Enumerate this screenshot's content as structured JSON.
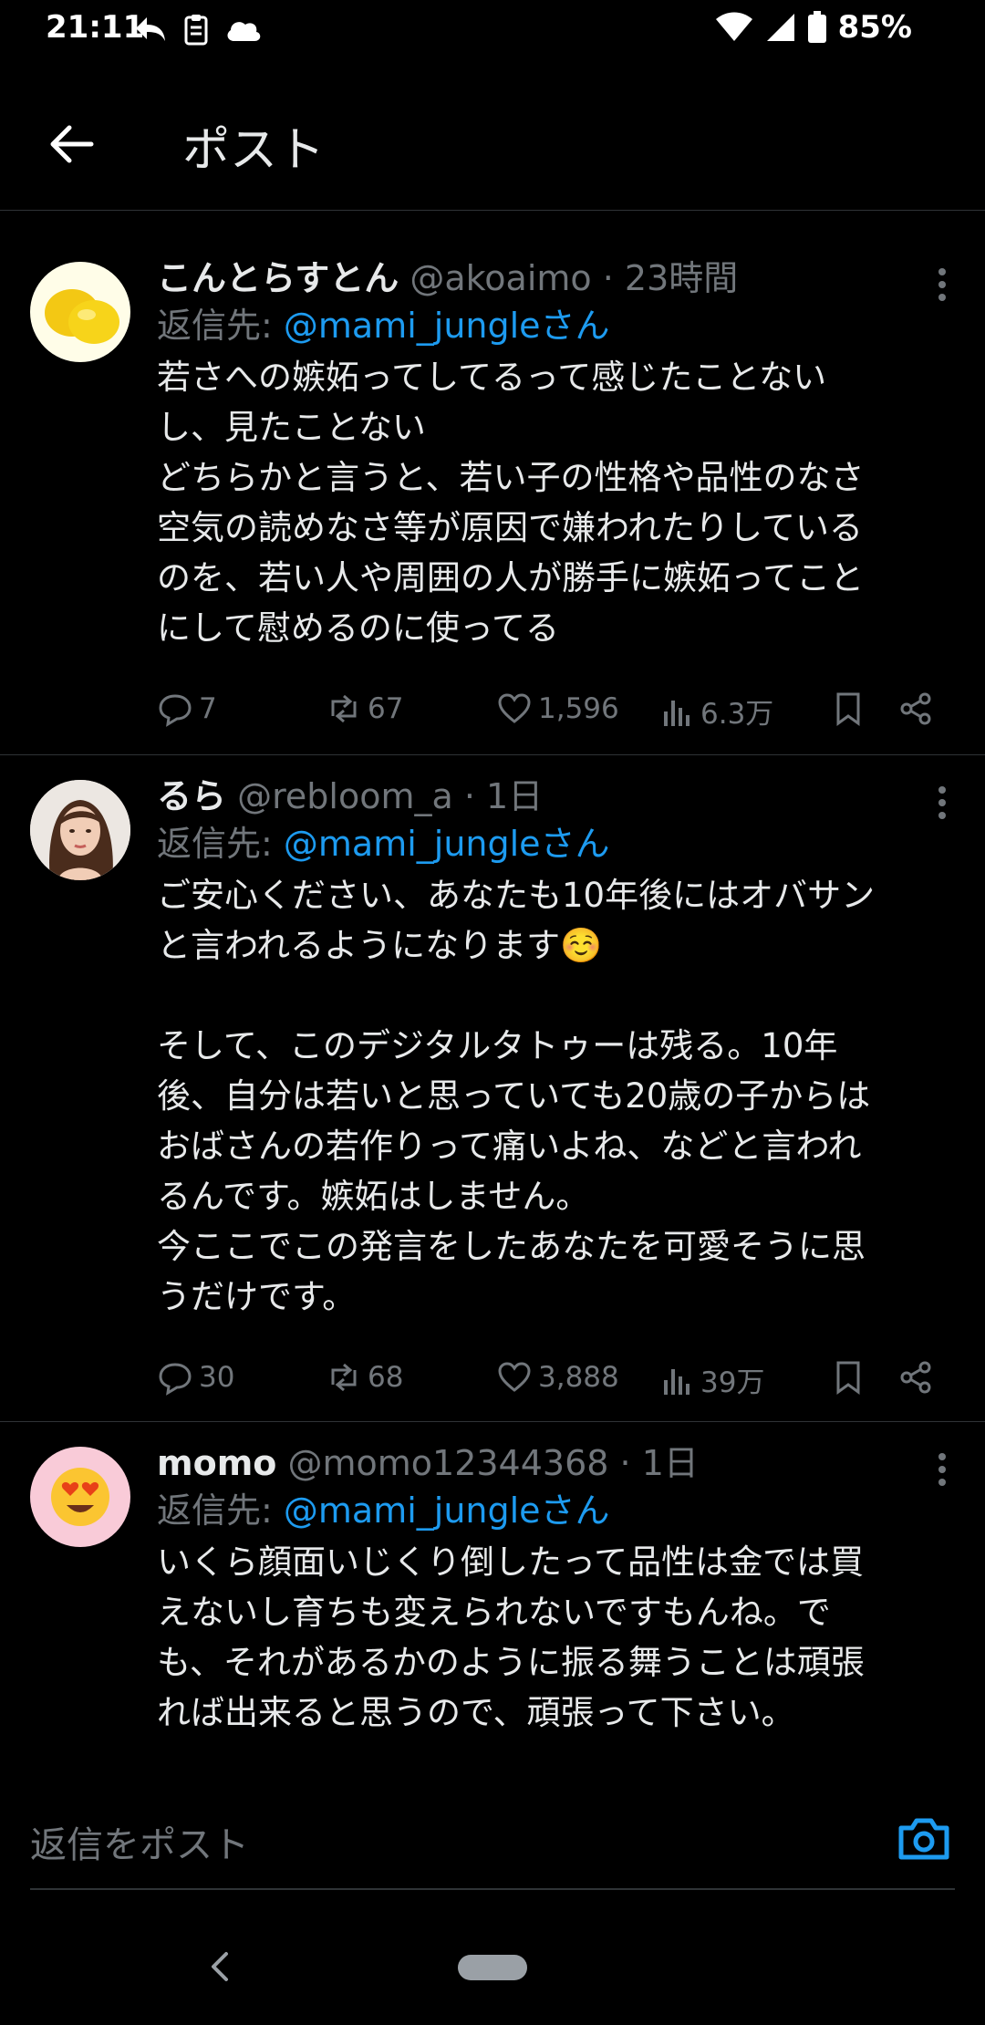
{
  "status_bar": {
    "time": "21:11",
    "battery": "85%"
  },
  "header": {
    "title": "ポスト"
  },
  "posts": [
    {
      "name": "こんとらすとん",
      "handle": "@akoaimo",
      "time": "23時間",
      "reply_prefix": "返信先: ",
      "reply_mention": "@mami_jungleさん",
      "text": "若さへの嫉妬ってしてるって感じたことない\nし、見たことない\nどちらかと言うと、若い子の性格や品性のなさ\n空気の読めなさ等が原因で嫌われたりしている\nのを、若い人や周囲の人が勝手に嫉妬ってこと\nにして慰めるのに使ってる",
      "replies": "7",
      "reposts": "67",
      "likes": "1,596",
      "views": "6.3万"
    },
    {
      "name": "るら",
      "handle": "@rebloom_a",
      "time": "1日",
      "reply_prefix": "返信先: ",
      "reply_mention": "@mami_jungleさん",
      "text": "ご安心ください、あなたも10年後にはオバサン\nと言われるようになります☺️\n\nそして、このデジタルタトゥーは残る。10年\n後、自分は若いと思っていても20歳の子からは\nおばさんの若作りって痛いよね、などと言われ\nるんです。嫉妬はしません。\n今ここでこの発言をしたあなたを可愛そうに思\nうだけです。",
      "replies": "30",
      "reposts": "68",
      "likes": "3,888",
      "views": "39万"
    },
    {
      "name": "momo",
      "handle": "@momo12344368",
      "time": "1日",
      "reply_prefix": "返信先: ",
      "reply_mention": "@mami_jungleさん",
      "text": "いくら顔面いじくり倒したって品性は金では買\nえないし育ちも変えられないですもんね。で\nも、それがあるかのように振る舞うことは頑張\nれば出来ると思うので、頑張って下さい。"
    }
  ],
  "composer": {
    "placeholder": "返信をポスト"
  },
  "colors": {
    "accent": "#1d9bf0",
    "muted": "#71767b",
    "divider": "#2f3336"
  }
}
